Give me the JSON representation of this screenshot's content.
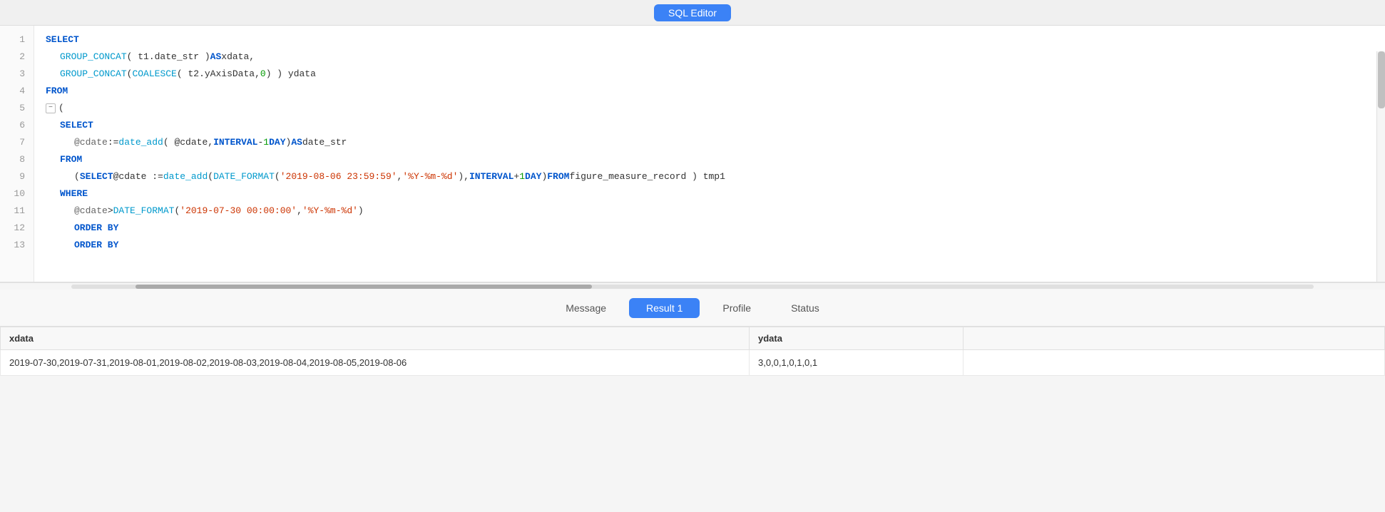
{
  "topbar": {
    "sql_editor_label": "SQL Editor"
  },
  "tabs": {
    "message": "Message",
    "result1": "Result 1",
    "profile": "Profile",
    "status": "Status"
  },
  "editor": {
    "lines": [
      {
        "num": 1,
        "indent": 0,
        "fold": false,
        "tokens": [
          {
            "type": "kw-blue",
            "text": "SELECT"
          }
        ]
      },
      {
        "num": 2,
        "indent": 1,
        "fold": false,
        "tokens": [
          {
            "type": "kw-cyan",
            "text": "GROUP_CONCAT"
          },
          {
            "type": "kw-plain",
            "text": "( t1.date_str ) "
          },
          {
            "type": "kw-blue",
            "text": "AS"
          },
          {
            "type": "kw-plain",
            "text": " xdata,"
          }
        ]
      },
      {
        "num": 3,
        "indent": 1,
        "fold": false,
        "tokens": [
          {
            "type": "kw-cyan",
            "text": "GROUP_CONCAT"
          },
          {
            "type": "kw-plain",
            "text": "( "
          },
          {
            "type": "kw-cyan",
            "text": "COALESCE"
          },
          {
            "type": "kw-plain",
            "text": "( t2.yAxisData, "
          },
          {
            "type": "kw-green",
            "text": "0"
          },
          {
            "type": "kw-plain",
            "text": " ) ) ydata"
          }
        ]
      },
      {
        "num": 4,
        "indent": 0,
        "fold": false,
        "tokens": [
          {
            "type": "kw-blue",
            "text": "FROM"
          }
        ]
      },
      {
        "num": 5,
        "indent": 0,
        "fold": true,
        "tokens": [
          {
            "type": "kw-plain",
            "text": "("
          }
        ]
      },
      {
        "num": 6,
        "indent": 1,
        "fold": false,
        "tokens": [
          {
            "type": "kw-blue",
            "text": "SELECT"
          }
        ]
      },
      {
        "num": 7,
        "indent": 2,
        "fold": false,
        "tokens": [
          {
            "type": "kw-var",
            "text": "@cdate"
          },
          {
            "type": "kw-plain",
            "text": " := "
          },
          {
            "type": "kw-cyan",
            "text": "date_add"
          },
          {
            "type": "kw-plain",
            "text": "( @cdate, "
          },
          {
            "type": "kw-blue",
            "text": "INTERVAL"
          },
          {
            "type": "kw-plain",
            "text": " - "
          },
          {
            "type": "kw-green",
            "text": "1"
          },
          {
            "type": "kw-plain",
            "text": " "
          },
          {
            "type": "kw-blue",
            "text": "DAY"
          },
          {
            "type": "kw-plain",
            "text": " ) "
          },
          {
            "type": "kw-blue",
            "text": "AS"
          },
          {
            "type": "kw-plain",
            "text": " date_str"
          }
        ]
      },
      {
        "num": 8,
        "indent": 1,
        "fold": false,
        "tokens": [
          {
            "type": "kw-blue",
            "text": "FROM"
          }
        ]
      },
      {
        "num": 9,
        "indent": 2,
        "fold": false,
        "tokens": [
          {
            "type": "kw-plain",
            "text": "( "
          },
          {
            "type": "kw-blue",
            "text": "SELECT"
          },
          {
            "type": "kw-plain",
            "text": " @cdate := "
          },
          {
            "type": "kw-cyan",
            "text": "date_add"
          },
          {
            "type": "kw-plain",
            "text": "( "
          },
          {
            "type": "kw-cyan",
            "text": "DATE_FORMAT"
          },
          {
            "type": "kw-plain",
            "text": "( "
          },
          {
            "type": "kw-red",
            "text": "'2019-08-06 23:59:59'"
          },
          {
            "type": "kw-plain",
            "text": ", "
          },
          {
            "type": "kw-red",
            "text": "'%Y-%m-%d'"
          },
          {
            "type": "kw-plain",
            "text": " ), "
          },
          {
            "type": "kw-blue",
            "text": "INTERVAL"
          },
          {
            "type": "kw-plain",
            "text": " + "
          },
          {
            "type": "kw-green",
            "text": "1"
          },
          {
            "type": "kw-plain",
            "text": " "
          },
          {
            "type": "kw-blue",
            "text": "DAY"
          },
          {
            "type": "kw-plain",
            "text": " ) "
          },
          {
            "type": "kw-blue",
            "text": "FROM"
          },
          {
            "type": "kw-plain",
            "text": " figure_measure_record ) tmp1"
          }
        ]
      },
      {
        "num": 10,
        "indent": 1,
        "fold": false,
        "tokens": [
          {
            "type": "kw-blue",
            "text": "WHERE"
          }
        ]
      },
      {
        "num": 11,
        "indent": 2,
        "fold": false,
        "tokens": [
          {
            "type": "kw-var",
            "text": "@cdate"
          },
          {
            "type": "kw-plain",
            "text": " > "
          },
          {
            "type": "kw-cyan",
            "text": "DATE_FORMAT"
          },
          {
            "type": "kw-plain",
            "text": "( "
          },
          {
            "type": "kw-red",
            "text": "'2019-07-30 00:00:00'"
          },
          {
            "type": "kw-plain",
            "text": ", "
          },
          {
            "type": "kw-red",
            "text": "'%Y-%m-%d'"
          },
          {
            "type": "kw-plain",
            "text": " )"
          }
        ]
      },
      {
        "num": 12,
        "indent": 1,
        "fold": false,
        "tokens": [
          {
            "type": "kw-blue",
            "text": "ORDER BY"
          }
        ]
      }
    ]
  },
  "results": {
    "headers": [
      "xdata",
      "ydata"
    ],
    "rows": [
      {
        "xdata": "2019-07-30,2019-07-31,2019-08-01,2019-08-02,2019-08-03,2019-08-04,2019-08-05,2019-08-06",
        "ydata": "3,0,0,1,0,1,0,1"
      }
    ]
  }
}
